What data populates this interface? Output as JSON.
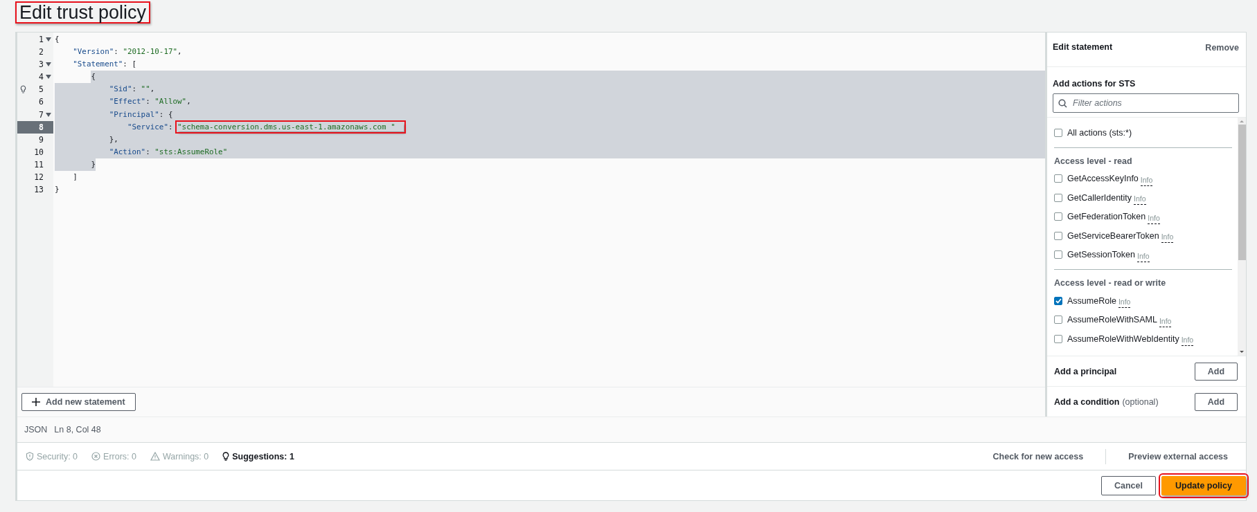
{
  "page_title": {
    "text": "Edit trust policy",
    "annotated": true
  },
  "editor": {
    "lines": [
      {
        "number": "1",
        "code": "{",
        "fold": true,
        "selected": false,
        "current": false,
        "hint": false,
        "annotated": false
      },
      {
        "number": "2",
        "code": "    \"Version\": \"2012-10-17\",",
        "fold": false,
        "selected": false,
        "current": false,
        "hint": false,
        "annotated": false
      },
      {
        "number": "3",
        "code": "    \"Statement\": [",
        "fold": true,
        "selected": false,
        "current": false,
        "hint": false,
        "annotated": false
      },
      {
        "number": "4",
        "code": "        {",
        "fold": true,
        "selected": true,
        "current": false,
        "hint": false,
        "annotated": false
      },
      {
        "number": "5",
        "code": "            \"Sid\": \"\",",
        "fold": false,
        "selected": true,
        "current": false,
        "hint": true,
        "annotated": false
      },
      {
        "number": "6",
        "code": "            \"Effect\": \"Allow\",",
        "fold": false,
        "selected": true,
        "current": false,
        "hint": false,
        "annotated": false
      },
      {
        "number": "7",
        "code": "            \"Principal\": {",
        "fold": true,
        "selected": true,
        "current": false,
        "hint": false,
        "annotated": false
      },
      {
        "number": "8",
        "code": "                \"Service\": \"schema-conversion.dms.us-east-1.amazonaws.com \"",
        "fold": false,
        "selected": true,
        "current": true,
        "hint": false,
        "annotated": true
      },
      {
        "number": "9",
        "code": "            },",
        "fold": false,
        "selected": true,
        "current": false,
        "hint": false,
        "annotated": false
      },
      {
        "number": "10",
        "code": "            \"Action\": \"sts:AssumeRole\"",
        "fold": false,
        "selected": true,
        "current": false,
        "hint": false,
        "annotated": false
      },
      {
        "number": "11",
        "code": "        }",
        "fold": false,
        "selected": true,
        "current": false,
        "hint": false,
        "annotated": false
      },
      {
        "number": "12",
        "code": "    ]",
        "fold": false,
        "selected": false,
        "current": false,
        "hint": false,
        "annotated": false
      },
      {
        "number": "13",
        "code": "}",
        "fold": false,
        "selected": false,
        "current": false,
        "hint": false,
        "annotated": false
      }
    ],
    "add_statement_button": "Add new statement"
  },
  "statement_panel": {
    "title": "Edit statement",
    "remove": "Remove",
    "actions_title": "Add actions for STS",
    "filter": {
      "placeholder": "Filter actions"
    },
    "all_actions": {
      "label": "All actions (sts:*)",
      "checked": false
    },
    "groups": [
      {
        "title": "Access level - read",
        "items": [
          {
            "label": "GetAccessKeyInfo",
            "info": "Info",
            "checked": false
          },
          {
            "label": "GetCallerIdentity",
            "info": "Info",
            "checked": false
          },
          {
            "label": "GetFederationToken",
            "info": "Info",
            "checked": false
          },
          {
            "label": "GetServiceBearerToken",
            "info": "Info",
            "checked": false
          },
          {
            "label": "GetSessionToken",
            "info": "Info",
            "checked": false
          }
        ]
      },
      {
        "title": "Access level - read or write",
        "items": [
          {
            "label": "AssumeRole",
            "info": "Info",
            "checked": true
          },
          {
            "label": "AssumeRoleWithSAML",
            "info": "Info",
            "checked": false
          },
          {
            "label": "AssumeRoleWithWebIdentity",
            "info": "Info",
            "checked": false
          }
        ]
      }
    ],
    "sections": [
      {
        "title": "Add a principal",
        "button": "Add"
      },
      {
        "title": "Add a condition",
        "note": "(optional)",
        "button": "Add"
      }
    ]
  },
  "status": {
    "language": "JSON",
    "position": "Ln 8, Col 48"
  },
  "findings": [
    {
      "kind": "security",
      "text": "Security: 0",
      "active": false
    },
    {
      "kind": "errors",
      "text": "Errors: 0",
      "active": false
    },
    {
      "kind": "warnings",
      "text": "Warnings: 0",
      "active": false
    },
    {
      "kind": "suggestions",
      "text": "Suggestions: 1",
      "active": true
    }
  ],
  "access_links": [
    "Check for new access",
    "Preview external access"
  ],
  "buttons": [
    {
      "label": "Cancel",
      "kind": "secondary",
      "annotated": false
    },
    {
      "label": "Update policy",
      "kind": "primary",
      "annotated": true
    }
  ]
}
